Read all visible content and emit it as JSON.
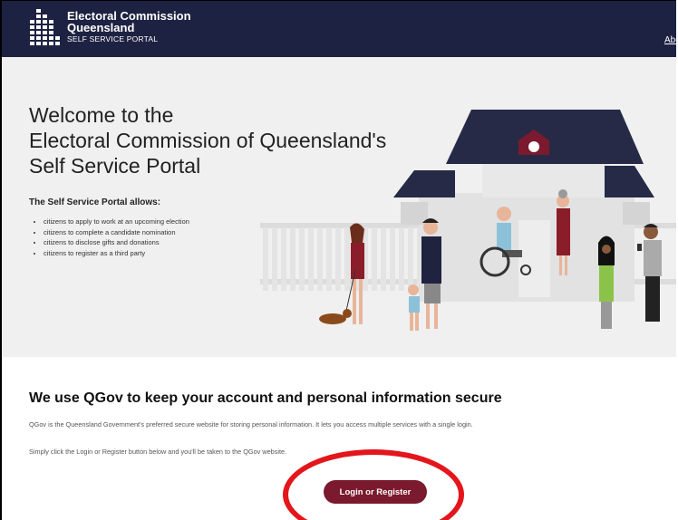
{
  "header": {
    "brand_line1": "Electoral Commission",
    "brand_line2": "Queensland",
    "brand_line3": "SELF SERVICE PORTAL",
    "about_link": "Abo"
  },
  "hero": {
    "title_line1": "Welcome to the",
    "title_line2": "Electoral Commission of Queensland's",
    "title_line3": "Self Service Portal",
    "allows_heading": "The Self Service Portal allows:",
    "bullets": [
      "citizens to apply to work at an upcoming election",
      "citizens to complete a candidate nomination",
      "citizens to disclose gifts and donations",
      "citizens to register as a third party"
    ]
  },
  "info": {
    "heading": "We use QGov to keep your account and personal information secure",
    "paragraph1": "QGov is the Queensland Government's preferred secure website for storing personal information. It lets you access multiple services with a single login.",
    "paragraph2": "Simply click the Login or Register button below and you'll be taken to the QGov website."
  },
  "login_button": "Login or Register",
  "colors": {
    "header_bg": "#1e2242",
    "hero_bg": "#f0f0f0",
    "button_bg": "#7b1a2e",
    "annotation_ring": "#e3161c"
  },
  "icons": {
    "logo": "ecq-block-logo-icon"
  }
}
